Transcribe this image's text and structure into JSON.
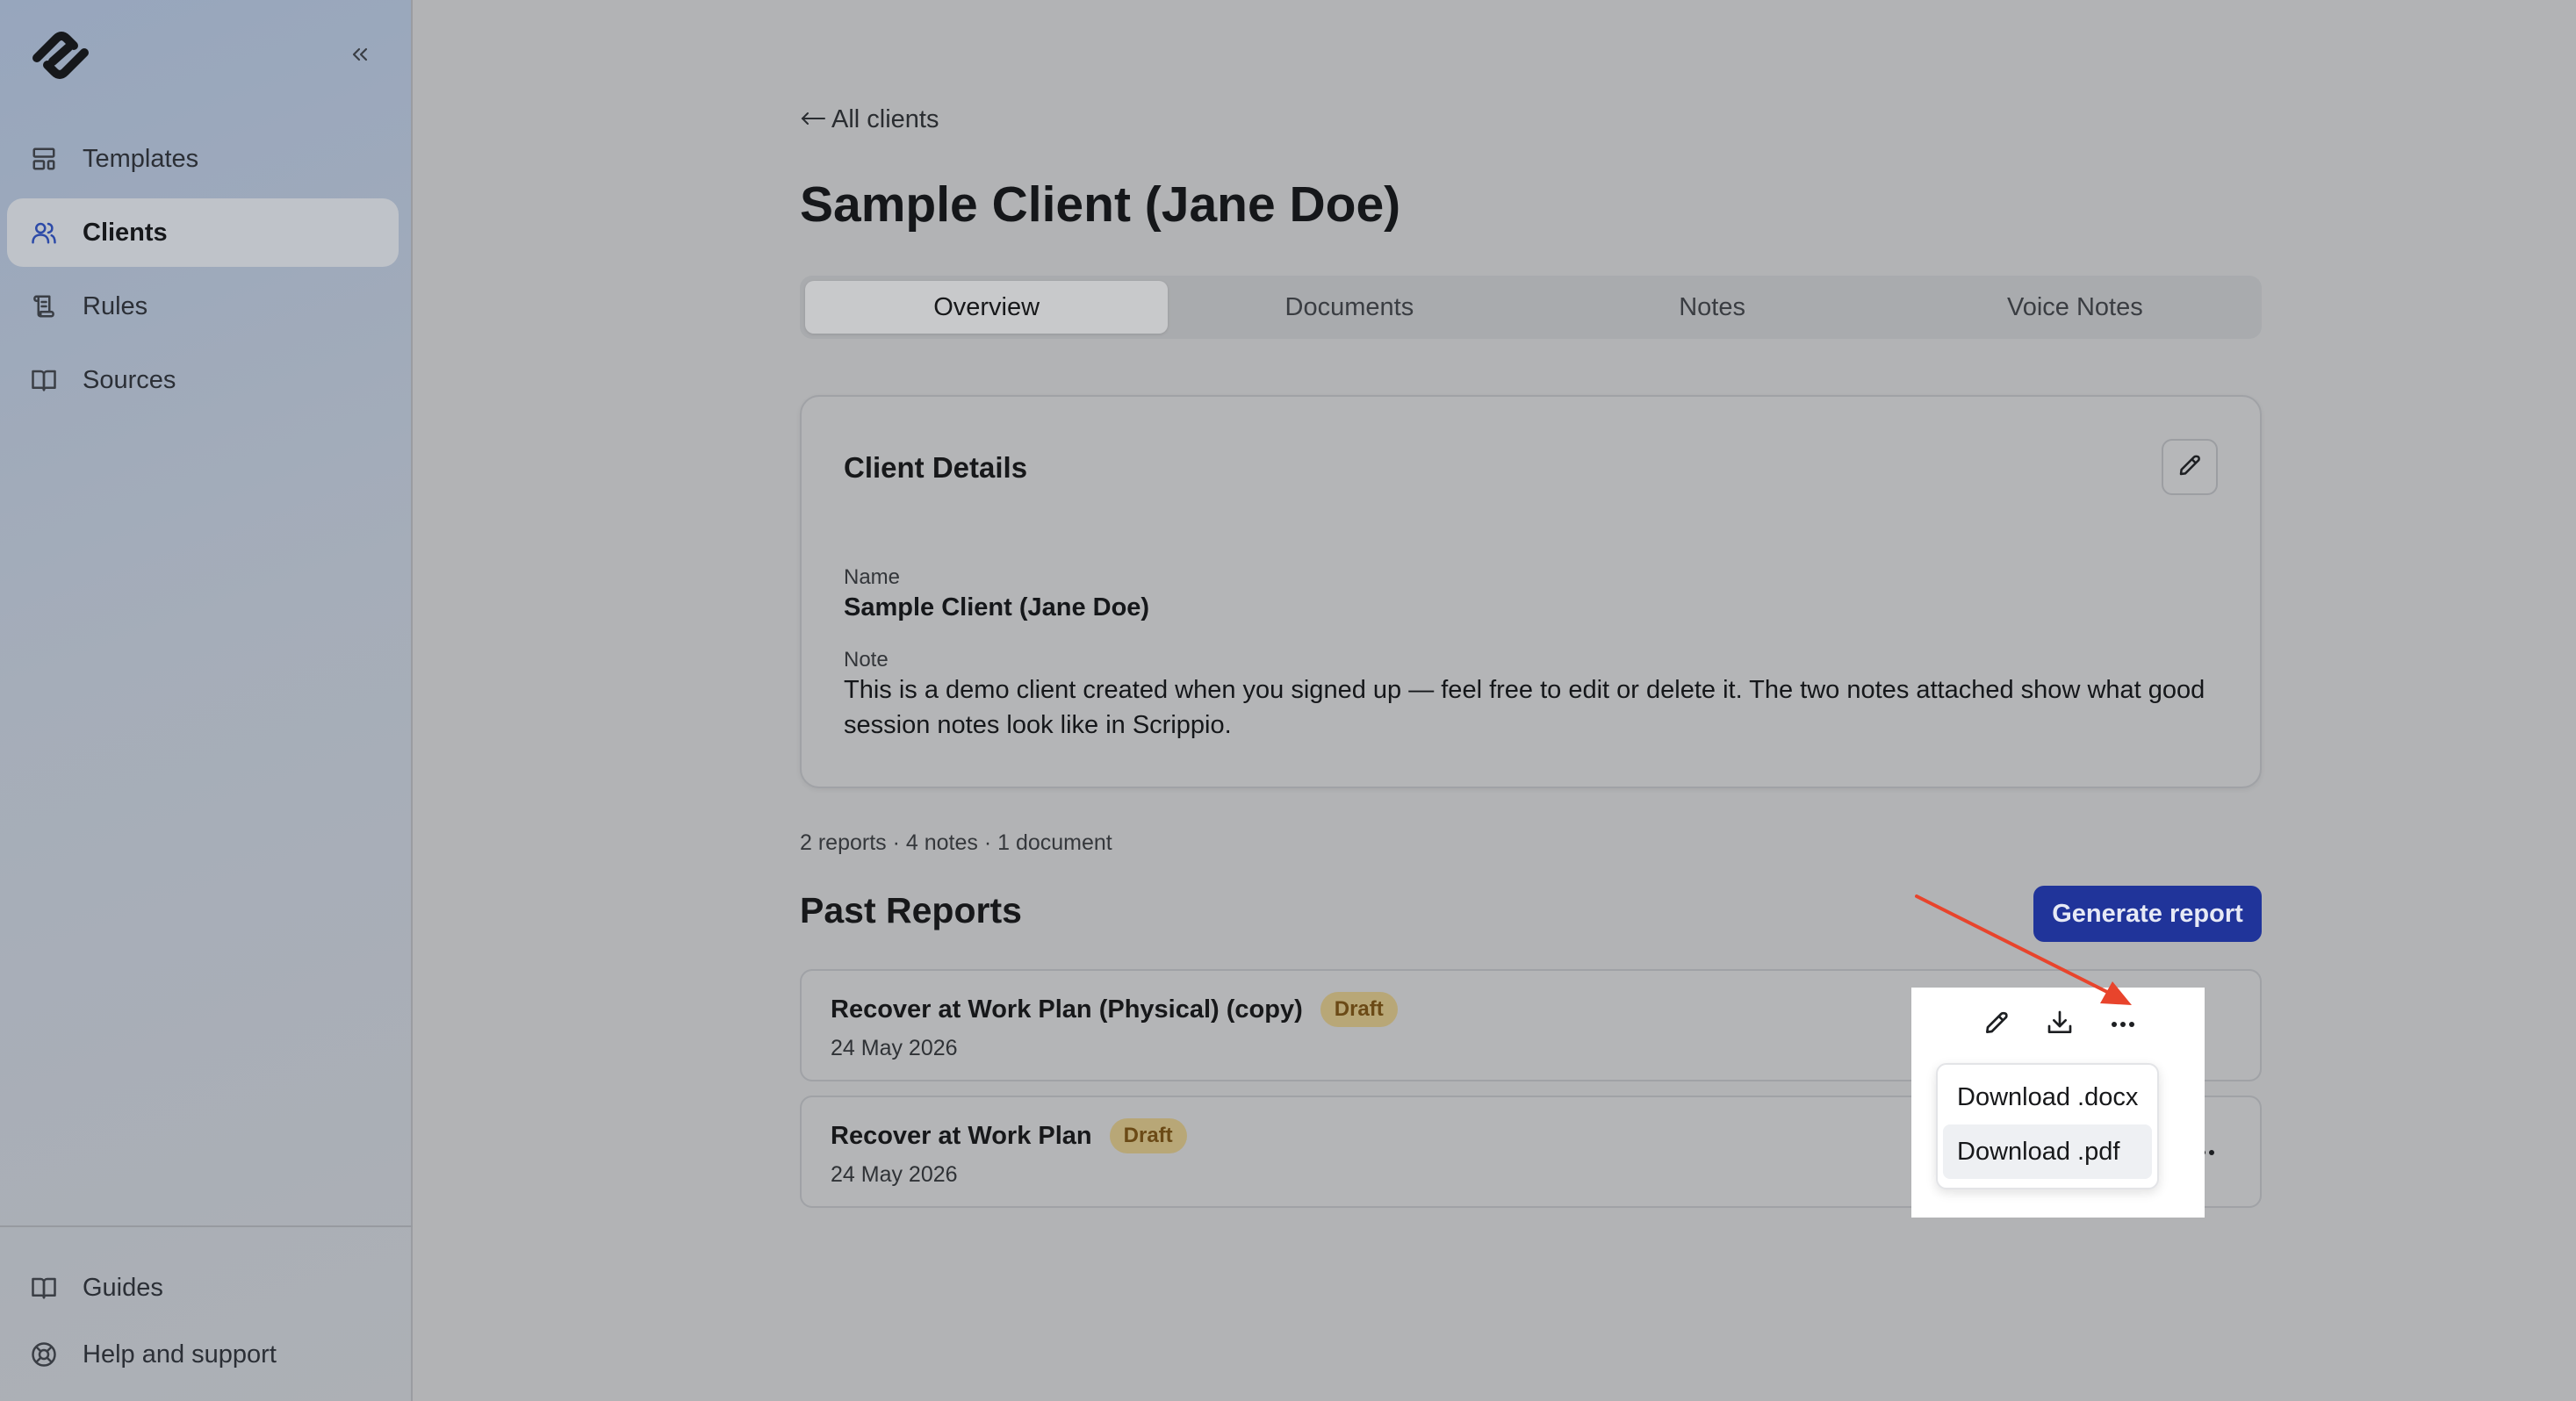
{
  "sidebar": {
    "items": [
      {
        "label": "Templates",
        "icon": "layout-template-icon"
      },
      {
        "label": "Clients",
        "icon": "users-icon",
        "active": true
      },
      {
        "label": "Rules",
        "icon": "scroll-icon"
      },
      {
        "label": "Sources",
        "icon": "book-open-icon"
      }
    ],
    "bottom_items": [
      {
        "label": "Guides",
        "icon": "book-icon"
      },
      {
        "label": "Help and support",
        "icon": "life-buoy-icon"
      }
    ]
  },
  "main": {
    "back_link": "All clients",
    "title": "Sample Client (Jane Doe)",
    "tabs": [
      {
        "label": "Overview",
        "active": true
      },
      {
        "label": "Documents"
      },
      {
        "label": "Notes"
      },
      {
        "label": "Voice Notes"
      }
    ],
    "client_details": {
      "title": "Client Details",
      "name_label": "Name",
      "name_value": "Sample Client (Jane Doe)",
      "note_label": "Note",
      "note_value": "This is a demo client created when you signed up — feel free to edit or delete it. The two notes attached show what good session notes look like in Scrippio."
    },
    "stats": "2 reports · 4 notes · 1 document",
    "past_reports": {
      "title": "Past Reports",
      "generate_label": "Generate report",
      "reports": [
        {
          "title": "Recover at Work Plan (Physical) (copy)",
          "status": "Draft",
          "date": "24 May 2026"
        },
        {
          "title": "Recover at Work Plan",
          "status": "Draft",
          "date": "24 May 2026"
        }
      ]
    },
    "download_menu": {
      "items": [
        "Download .docx",
        "Download .pdf"
      ],
      "hovered": "Download .pdf"
    }
  },
  "colors": {
    "accent": "#20349a",
    "badge_bg": "#b8a777",
    "badge_text": "#6b4a16",
    "annotation_arrow": "#e8442c"
  }
}
